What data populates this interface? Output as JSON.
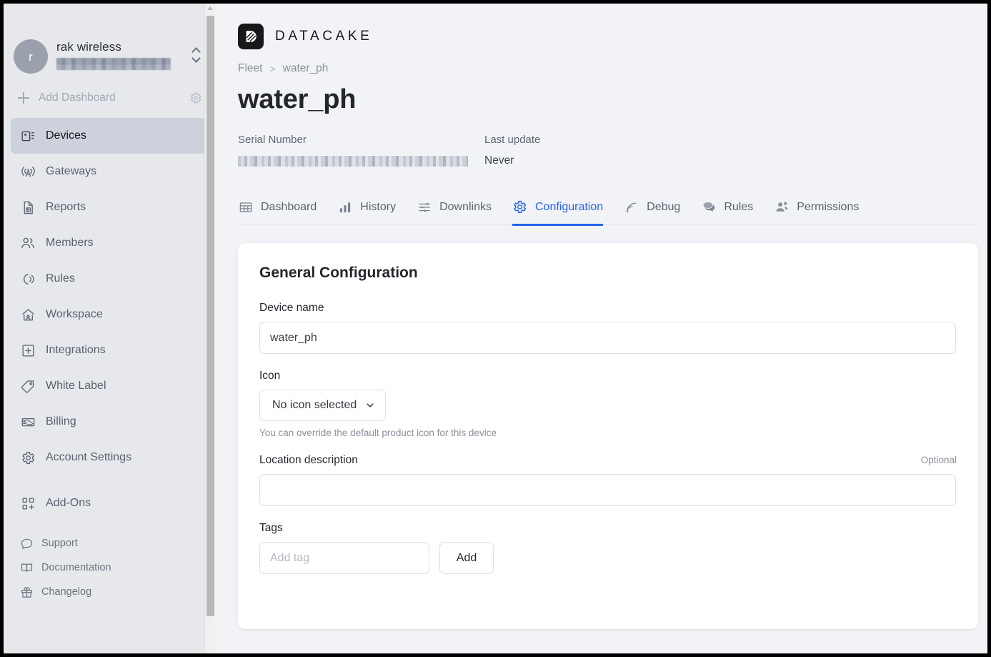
{
  "sidebar": {
    "workspace": {
      "avatar_initial": "r",
      "name": "rak wireless",
      "email_redacted": true
    },
    "add_dashboard": {
      "label": "Add Dashboard",
      "plus_icon": "plus-icon",
      "gear_icon": "gear-icon"
    },
    "nav": [
      {
        "label": "Devices",
        "icon": "devices-icon",
        "active": true
      },
      {
        "label": "Gateways",
        "icon": "antenna-icon",
        "active": false
      },
      {
        "label": "Reports",
        "icon": "document-chart-icon",
        "active": false
      },
      {
        "label": "Members",
        "icon": "users-icon",
        "active": false
      },
      {
        "label": "Rules",
        "icon": "broadcast-icon",
        "active": false
      },
      {
        "label": "Workspace",
        "icon": "home-user-icon",
        "active": false
      },
      {
        "label": "Integrations",
        "icon": "plus-square-icon",
        "active": false
      },
      {
        "label": "White Label",
        "icon": "tag-icon",
        "active": false
      },
      {
        "label": "Billing",
        "icon": "invoice-icon",
        "active": false
      },
      {
        "label": "Account Settings",
        "icon": "gear-icon",
        "active": false
      }
    ],
    "secondary_nav": [
      {
        "label": "Add-Ons",
        "icon": "grid-plus-icon"
      }
    ],
    "footer_nav": [
      {
        "label": "Support",
        "icon": "chat-bubble-icon"
      },
      {
        "label": "Documentation",
        "icon": "book-icon"
      },
      {
        "label": "Changelog",
        "icon": "gift-icon"
      }
    ]
  },
  "header": {
    "brand_name": "DATACAKE",
    "brand_icon": "datacake-logo-icon",
    "breadcrumb": {
      "root": "Fleet",
      "separator": ">",
      "current": "water_ph"
    },
    "page_title": "water_ph",
    "meta": [
      {
        "label": "Serial Number",
        "value": "",
        "redacted": true
      },
      {
        "label": "Last update",
        "value": "Never",
        "redacted": false
      }
    ]
  },
  "tabs": [
    {
      "label": "Dashboard",
      "icon": "table-icon",
      "active": false
    },
    {
      "label": "History",
      "icon": "bar-chart-icon",
      "active": false
    },
    {
      "label": "Downlinks",
      "icon": "sliders-icon",
      "active": false
    },
    {
      "label": "Configuration",
      "icon": "gear-icon",
      "active": true
    },
    {
      "label": "Debug",
      "icon": "signal-icon",
      "active": false
    },
    {
      "label": "Rules",
      "icon": "chat-bubble-icon",
      "active": false
    },
    {
      "label": "Permissions",
      "icon": "users-icon",
      "active": false
    }
  ],
  "config_card": {
    "title": "General Configuration",
    "device_name": {
      "label": "Device name",
      "value": "water_ph"
    },
    "icon_select": {
      "label": "Icon",
      "selected": "No icon selected",
      "chevron_icon": "chevron-down-icon",
      "hint": "You can override the default product icon for this device"
    },
    "location": {
      "label": "Location description",
      "optional_label": "Optional",
      "value": "",
      "placeholder": ""
    },
    "tags": {
      "label": "Tags",
      "placeholder": "Add tag",
      "value": "",
      "add_button": "Add"
    }
  },
  "colors": {
    "accent": "#2563eb",
    "sidebar_bg": "#e6e8ec",
    "page_bg": "#f1f3f6",
    "card_bg": "#ffffff",
    "brand_dark": "#17181a"
  }
}
